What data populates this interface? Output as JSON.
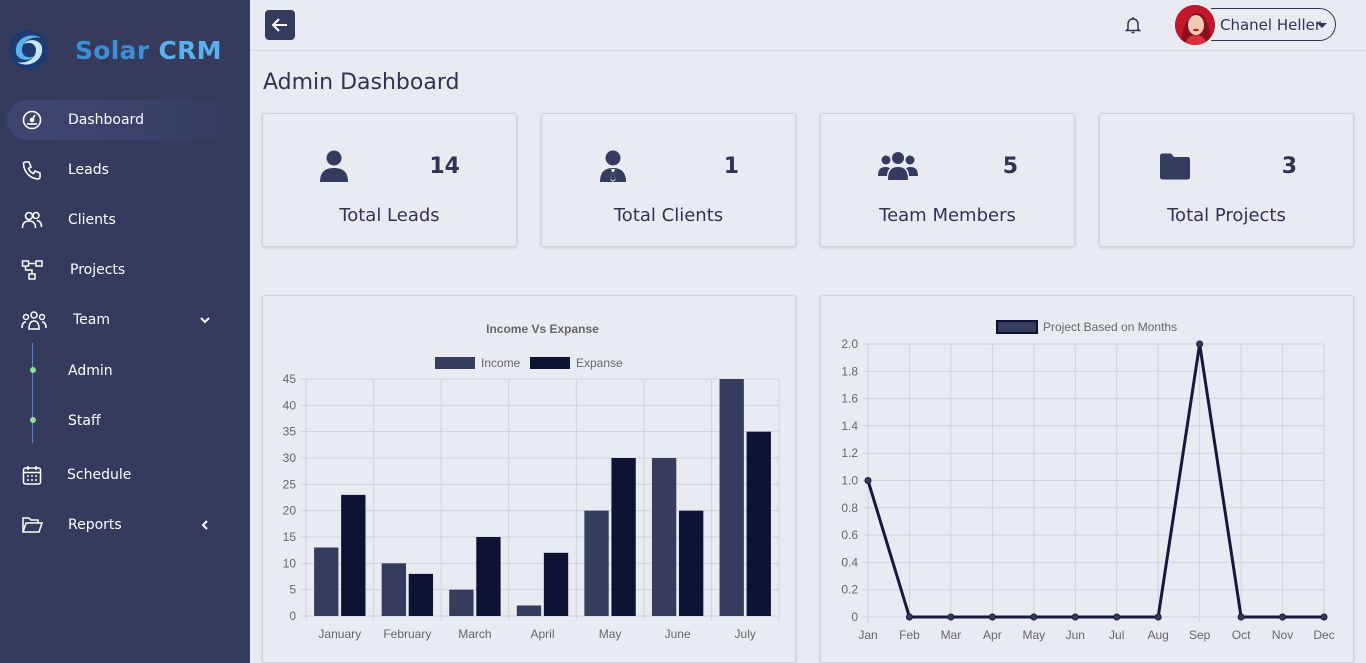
{
  "brand": {
    "part1": "Solar",
    "part2": "CRM"
  },
  "sidebar": {
    "items": [
      {
        "label": "Dashboard"
      },
      {
        "label": "Leads"
      },
      {
        "label": "Clients"
      },
      {
        "label": "Projects"
      },
      {
        "label": "Team"
      },
      {
        "label": "Schedule"
      },
      {
        "label": "Reports"
      }
    ],
    "team_sub": [
      {
        "label": "Admin"
      },
      {
        "label": "Staff"
      }
    ]
  },
  "topbar": {
    "user_name": "Chanel Heller"
  },
  "page": {
    "title": "Admin Dashboard"
  },
  "stats": [
    {
      "value": "14",
      "label": "Total Leads",
      "icon": "user-icon"
    },
    {
      "value": "1",
      "label": "Total Clients",
      "icon": "user-tie-icon"
    },
    {
      "value": "5",
      "label": "Team Members",
      "icon": "users-icon"
    },
    {
      "value": "3",
      "label": "Total Projects",
      "icon": "folder-icon"
    }
  ],
  "colors": {
    "sidebar": "#353b5c",
    "income": "#363c5c",
    "expanse": "#0e1334",
    "background": "#e9ebf2"
  },
  "chart_data": [
    {
      "type": "bar",
      "title": "Income Vs Expanse",
      "categories": [
        "January",
        "February",
        "March",
        "April",
        "May",
        "June",
        "July"
      ],
      "series": [
        {
          "name": "Income",
          "values": [
            13,
            10,
            5,
            2,
            20,
            30,
            45
          ]
        },
        {
          "name": "Expanse",
          "values": [
            23,
            8,
            15,
            12,
            30,
            20,
            35
          ]
        }
      ],
      "ylim": [
        0,
        45
      ],
      "yticks": [
        0,
        5,
        10,
        15,
        20,
        25,
        30,
        35,
        40,
        45
      ],
      "legend": "top",
      "grid": true
    },
    {
      "type": "line",
      "title": "",
      "categories": [
        "Jan",
        "Feb",
        "Mar",
        "Apr",
        "May",
        "Jun",
        "Jul",
        "Aug",
        "Sep",
        "Oct",
        "Nov",
        "Dec"
      ],
      "series": [
        {
          "name": "Project Based on Months",
          "values": [
            1,
            0,
            0,
            0,
            0,
            0,
            0,
            0,
            2,
            0,
            0,
            0
          ]
        }
      ],
      "ylim": [
        0,
        2.0
      ],
      "yticks": [
        "0",
        "0.2",
        "0.4",
        "0.6",
        "0.8",
        "1.0",
        "1.2",
        "1.4",
        "1.6",
        "1.8",
        "2.0"
      ],
      "legend": "top",
      "grid": true
    }
  ]
}
